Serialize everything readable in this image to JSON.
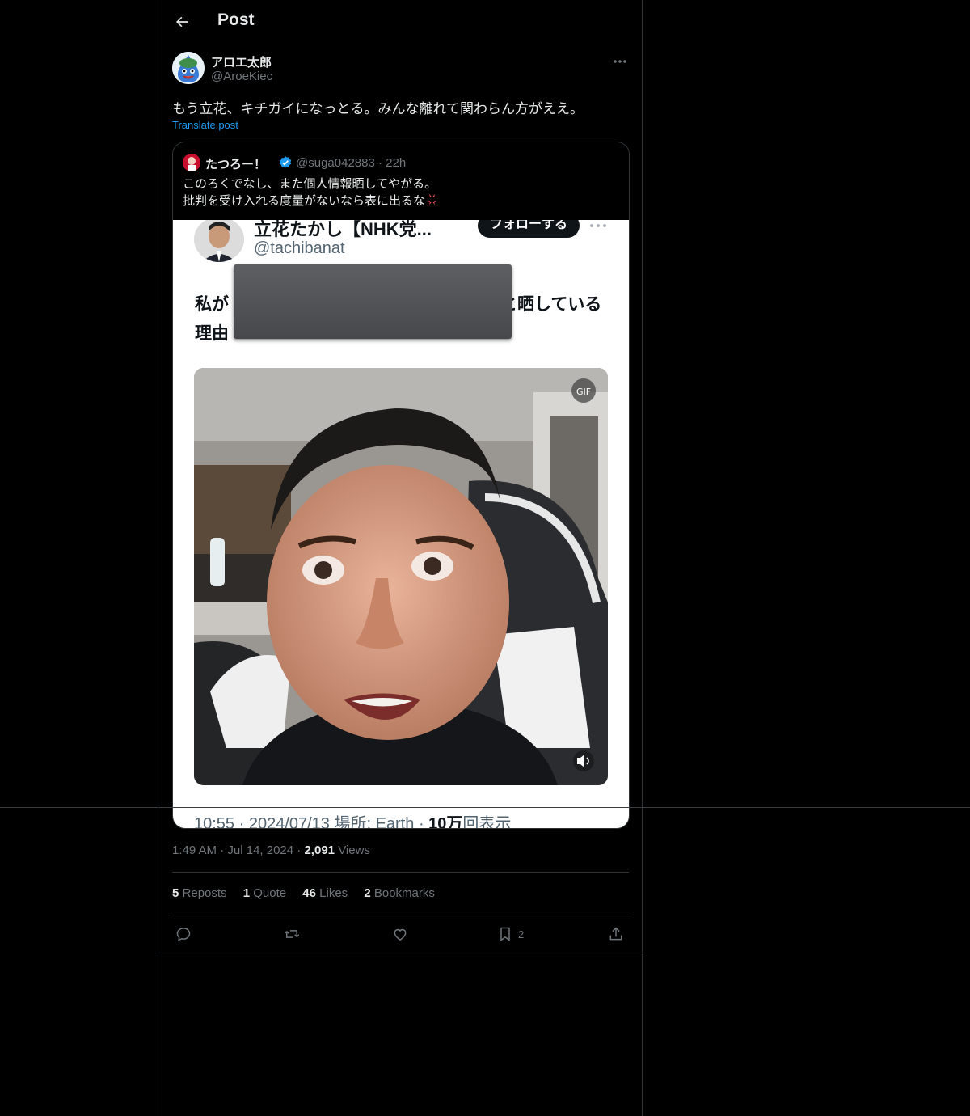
{
  "header": {
    "title": "Post"
  },
  "post": {
    "author_name": "アロエ太郎",
    "author_handle": "@AroeKiec",
    "text": "もう立花、キチガイになっとる。みんな離れて関わらん方がええ。",
    "translate_label": "Translate post",
    "time": "1:49 AM",
    "date": "Jul 14, 2024",
    "views_count": "2,091",
    "views_label": "Views"
  },
  "quote": {
    "name": "たつろー！",
    "handle_time": "@suga042883 · 22h",
    "line1": "このろくでなし、また個人情報晒してやがる。",
    "line2": "批判を受け入れる度量がないなら表に出るな"
  },
  "media": {
    "name": "立花たかし【NHK党...",
    "handle": "@tachibanat",
    "follow_label": "フォローする",
    "text_line1_start": "私が",
    "text_line1_end": "と晒している",
    "text_line2": "理由",
    "footer_prefix": "10:55 · 2024/07/13 場所: Earth · ",
    "footer_count": "10万",
    "footer_suffix": "回表示"
  },
  "stats": {
    "reposts_count": "5",
    "reposts_label": "Reposts",
    "quotes_count": "1",
    "quotes_label": "Quote",
    "likes_count": "46",
    "likes_label": "Likes",
    "bookmarks_count": "2",
    "bookmarks_label": "Bookmarks"
  },
  "actions": {
    "bookmark_count": "2"
  },
  "icons": [
    "back-arrow-icon",
    "more-icon",
    "verified-badge-icon",
    "anger-icon",
    "reply-icon",
    "repost-icon",
    "like-icon",
    "bookmark-icon",
    "share-icon",
    "gif-icon",
    "volume-icon"
  ],
  "colors": {
    "background": "#000000",
    "text": "#e7e9ea",
    "muted": "#71767b",
    "accent": "#1d9bf0",
    "border": "#2f3336"
  }
}
